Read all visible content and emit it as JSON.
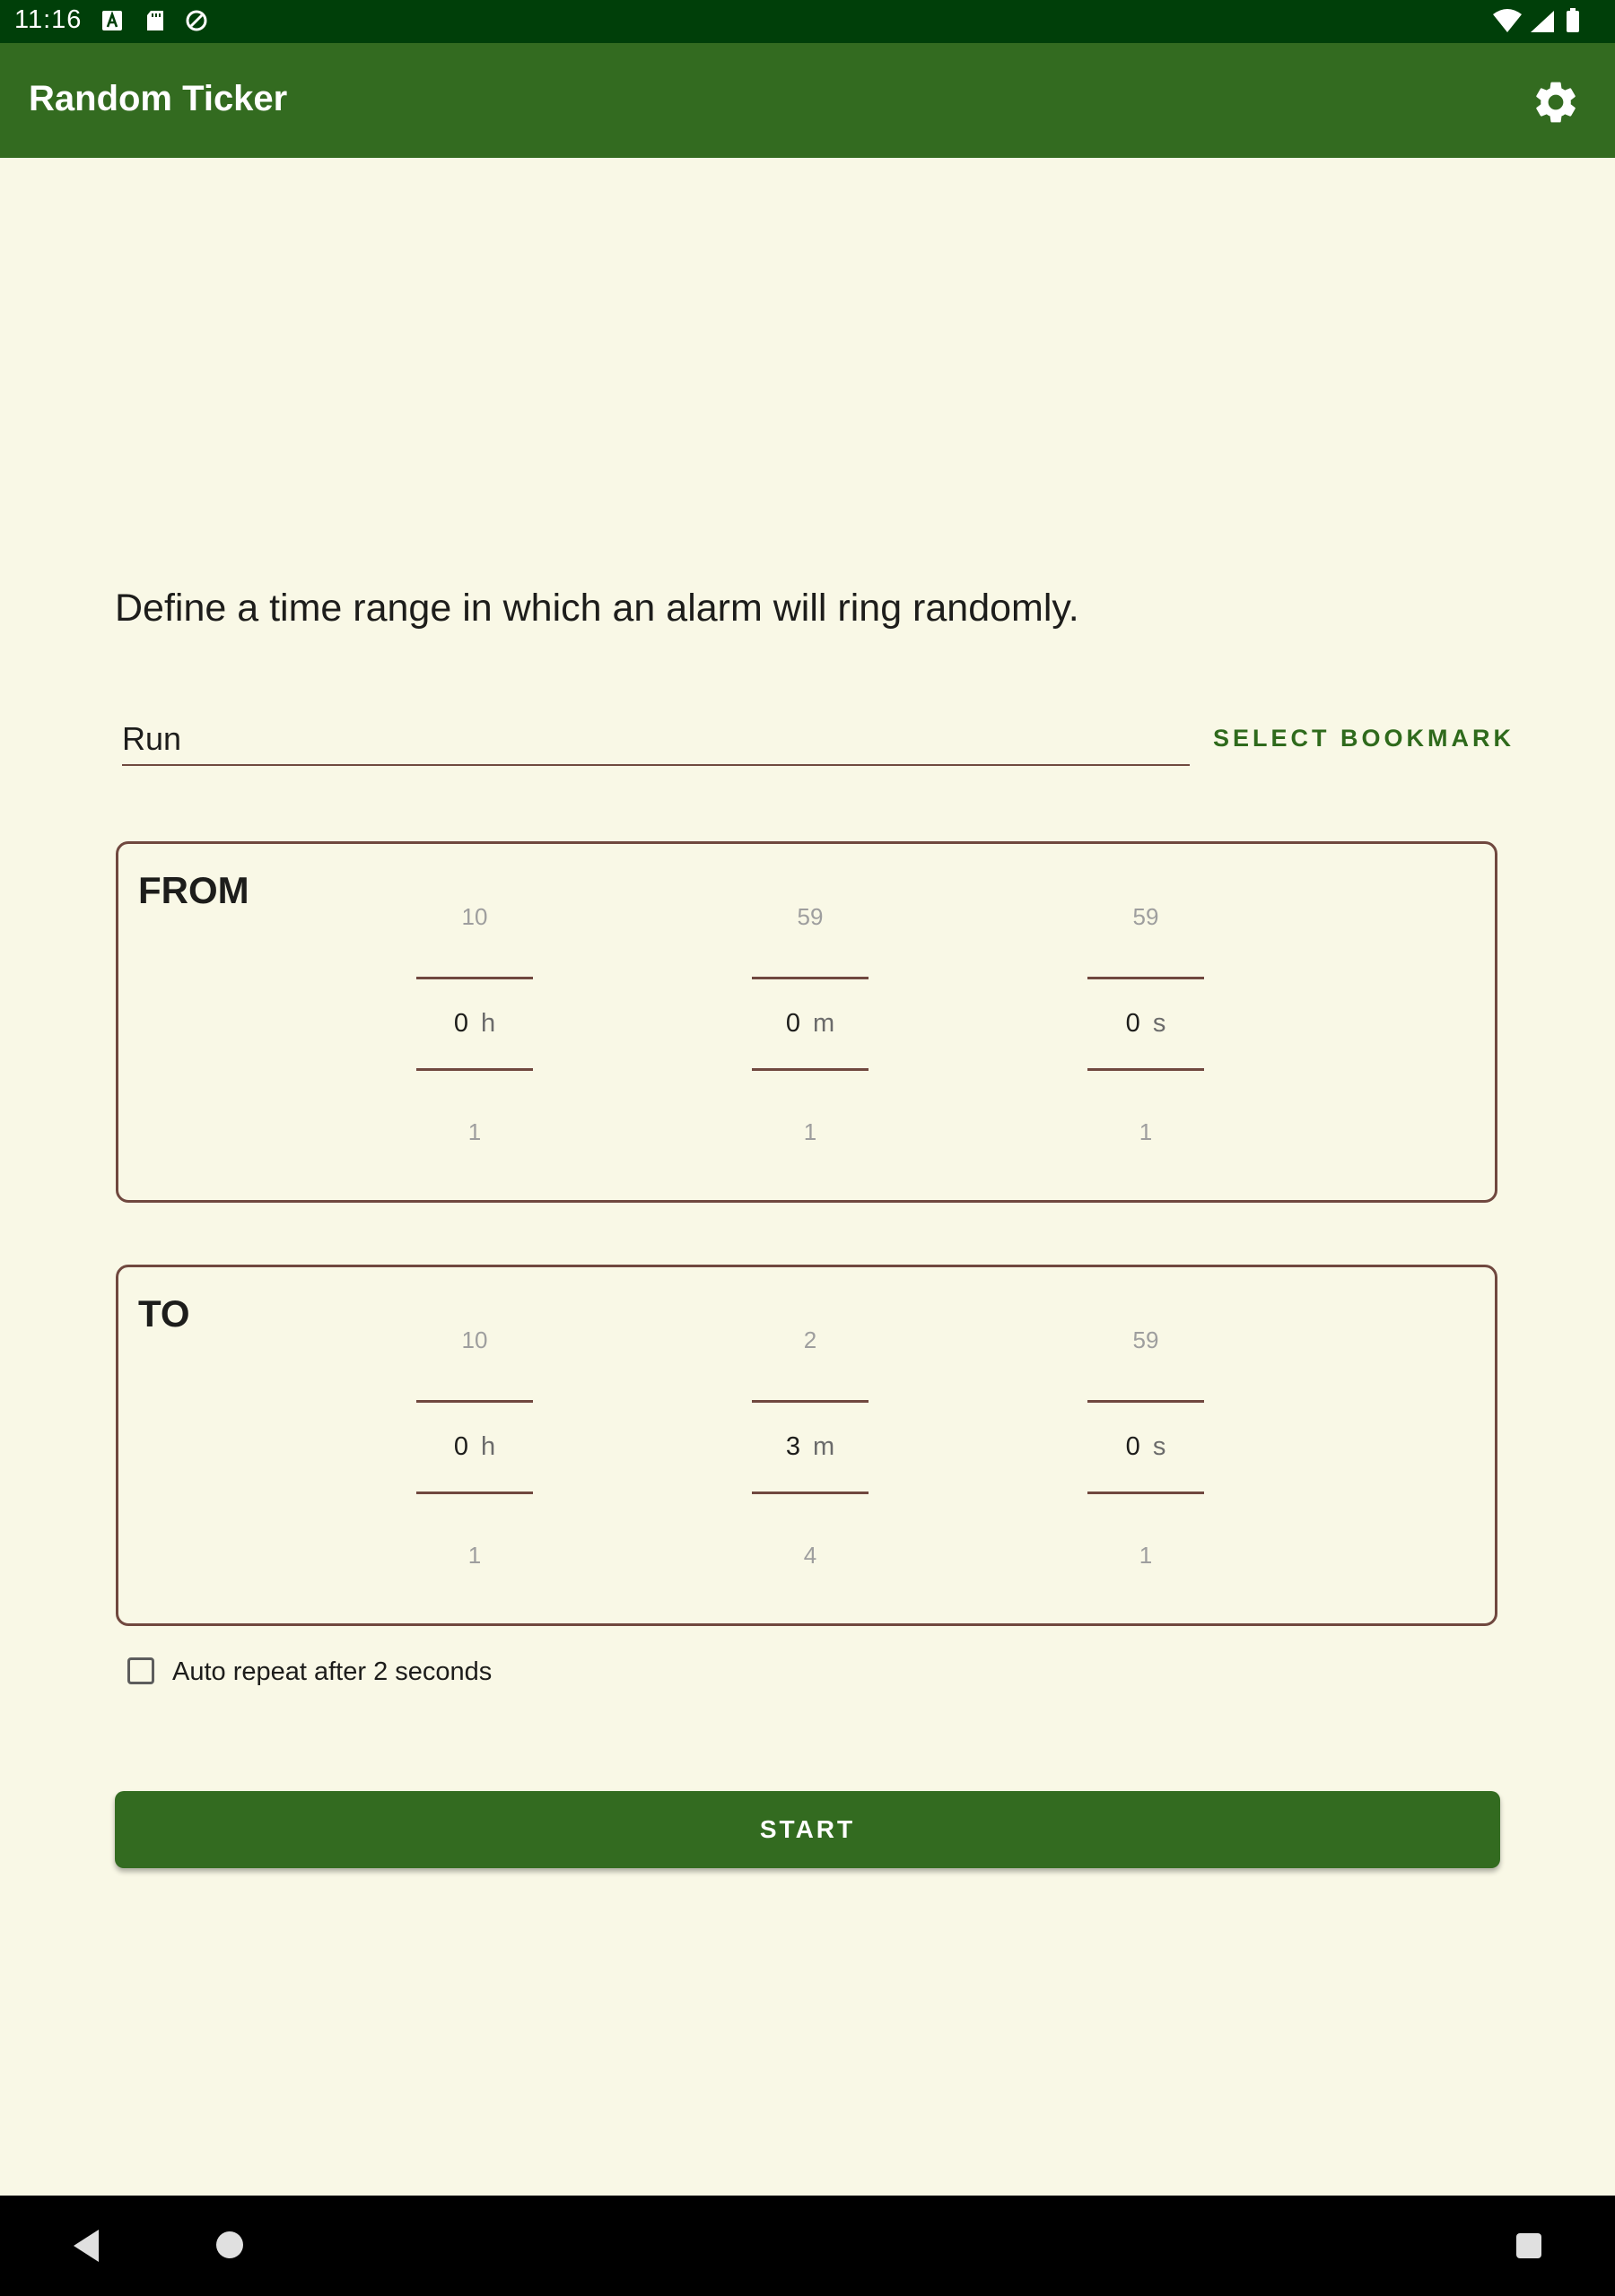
{
  "status_bar": {
    "time": "11:16"
  },
  "app_bar": {
    "title": "Random Ticker",
    "settings_icon": "gear-icon"
  },
  "main": {
    "description": "Define a time range in which an alarm will ring randomly.",
    "name_input": {
      "value": "Run"
    },
    "select_bookmark_label": "SELECT BOOKMARK",
    "from": {
      "title": "FROM",
      "hours": {
        "prev": "10",
        "value": "0",
        "next": "1",
        "unit": "h"
      },
      "minutes": {
        "prev": "59",
        "value": "0",
        "next": "1",
        "unit": "m"
      },
      "seconds": {
        "prev": "59",
        "value": "0",
        "next": "1",
        "unit": "s"
      }
    },
    "to": {
      "title": "TO",
      "hours": {
        "prev": "10",
        "value": "0",
        "next": "1",
        "unit": "h"
      },
      "minutes": {
        "prev": "2",
        "value": "3",
        "next": "4",
        "unit": "m"
      },
      "seconds": {
        "prev": "59",
        "value": "0",
        "next": "1",
        "unit": "s"
      }
    },
    "auto_repeat": {
      "label": "Auto repeat after 2 seconds",
      "checked": false
    },
    "start_label": "START"
  },
  "colors": {
    "status_bar": "#003f09",
    "app_bar": "#336b20",
    "background": "#f9f8e6",
    "accent_text": "#2f6a1c",
    "border": "#70483f"
  }
}
